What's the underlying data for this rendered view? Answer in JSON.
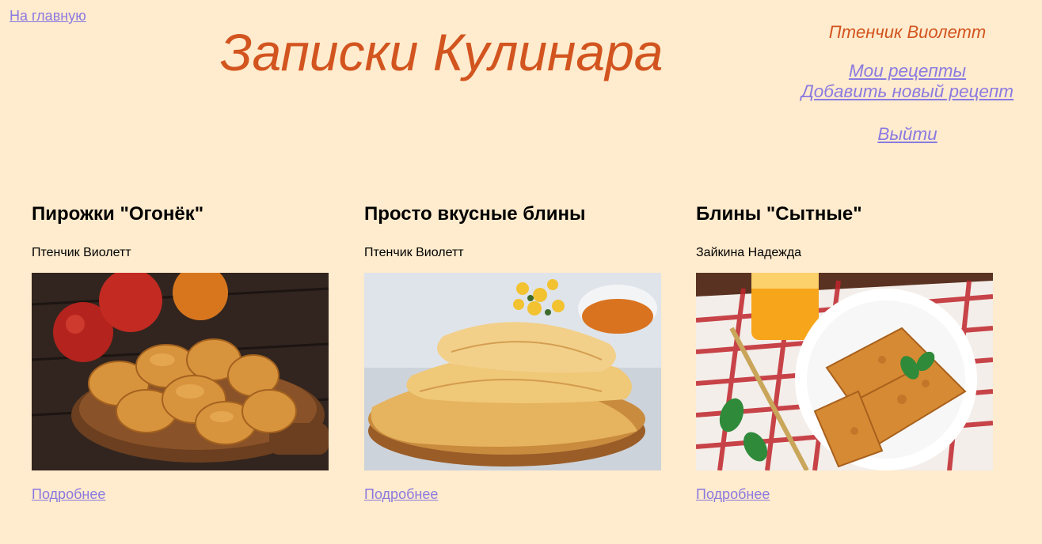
{
  "header": {
    "home_link": "На главную",
    "site_title": "Записки Кулинара"
  },
  "user_panel": {
    "user_name": "Птенчик Виолетт",
    "my_recipes": "Мои рецепты",
    "add_recipe": "Добавить новый рецепт",
    "logout": "Выйти"
  },
  "recipes": [
    {
      "title": "Пирожки \"Огонёк\"",
      "author": "Птенчик Виолетт",
      "image_icon": "pies-with-apples-photo",
      "details_link": "Подробнее"
    },
    {
      "title": "Просто вкусные блины",
      "author": "Птенчик Виолетт",
      "image_icon": "pancakes-with-jam-photo",
      "details_link": "Подробнее"
    },
    {
      "title": "Блины \"Сытные\"",
      "author": "Зайкина Надежда",
      "image_icon": "stuffed-pancakes-with-juice-photo",
      "details_link": "Подробнее"
    }
  ],
  "colors": {
    "page_background": "#ffebcd",
    "title_accent": "#d2541f",
    "link": "#8a7ae0"
  }
}
